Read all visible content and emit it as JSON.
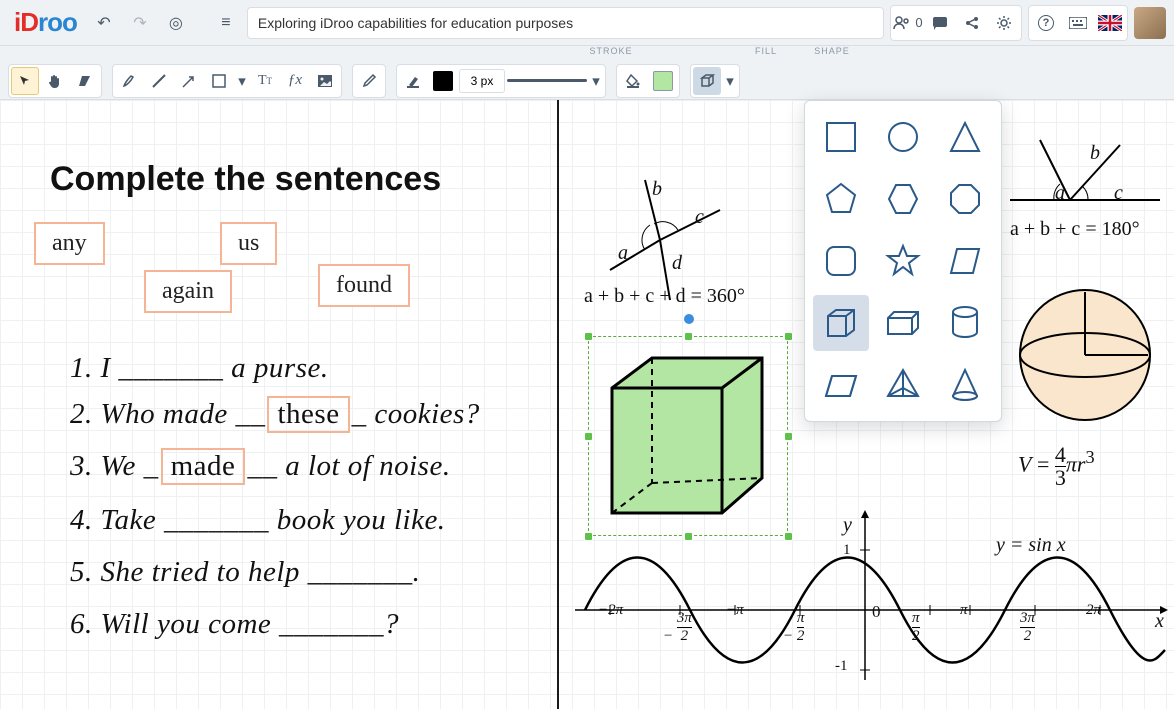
{
  "header": {
    "logo_i": "iD",
    "logo_d": "roo",
    "title": "Exploring iDroo capabilities for education purposes",
    "user_count": "0"
  },
  "toolbar": {
    "labels": {
      "stroke": "STROKE",
      "fill": "FILL",
      "shape": "SHAPE"
    },
    "stroke_width": "3 px",
    "stroke_color": "#000000",
    "fill_color": "#b3e6a3"
  },
  "left": {
    "heading": "Complete the sentences",
    "words": {
      "any": "any",
      "us": "us",
      "again": "again",
      "found": "found"
    },
    "s1": "1. I _______ a purse.",
    "s2a": "2. Who made __",
    "s2b": "these",
    "s2c": "_ cookies?",
    "s3a": "3. We _",
    "s3b": "made",
    "s3c": "__ a lot of noise.",
    "s4": "4. Take _______ book you like.",
    "s5": "5. She tried to help _______.",
    "s6": "6. Will you come _______?"
  },
  "math": {
    "eq1": "a + b + c + d = 360°",
    "labels1": {
      "a": "a",
      "b": "b",
      "c": "c",
      "d": "d"
    },
    "eq2": "a + b + c = 180°",
    "labels2": {
      "a": "a",
      "b": "b",
      "c": "c"
    },
    "volume": "V = (4/3)πr³",
    "sin": "y = sin x",
    "axis": {
      "ylab": "y",
      "xlab": "x",
      "one": "1",
      "neg1": "-1",
      "zero": "0",
      "t_m2pi": "−2π",
      "t_m3pi2": "3π/2",
      "t_mpi": "−π",
      "t_mpi2": "π/2",
      "t_pi2": "π/2",
      "t_pi": "π",
      "t_3pi2": "3π/2",
      "t_2pi": "2π"
    }
  },
  "chart_data": {
    "type": "line",
    "title": "y = sin x",
    "xlabel": "x",
    "ylabel": "y",
    "x": [
      "-2π",
      "-3π/2",
      "-π",
      "-π/2",
      "0",
      "π/2",
      "π",
      "3π/2",
      "2π"
    ],
    "values": [
      0,
      1,
      0,
      -1,
      0,
      1,
      0,
      -1,
      0
    ],
    "ylim": [
      -1,
      1
    ]
  },
  "shapes_popover": {
    "items": [
      "square",
      "circle",
      "triangle",
      "pentagon",
      "hexagon",
      "octagon",
      "rounded-square",
      "star",
      "parallelogram",
      "cube",
      "cuboid",
      "cylinder",
      "prism",
      "pyramid",
      "cone"
    ],
    "selected": "cube"
  }
}
